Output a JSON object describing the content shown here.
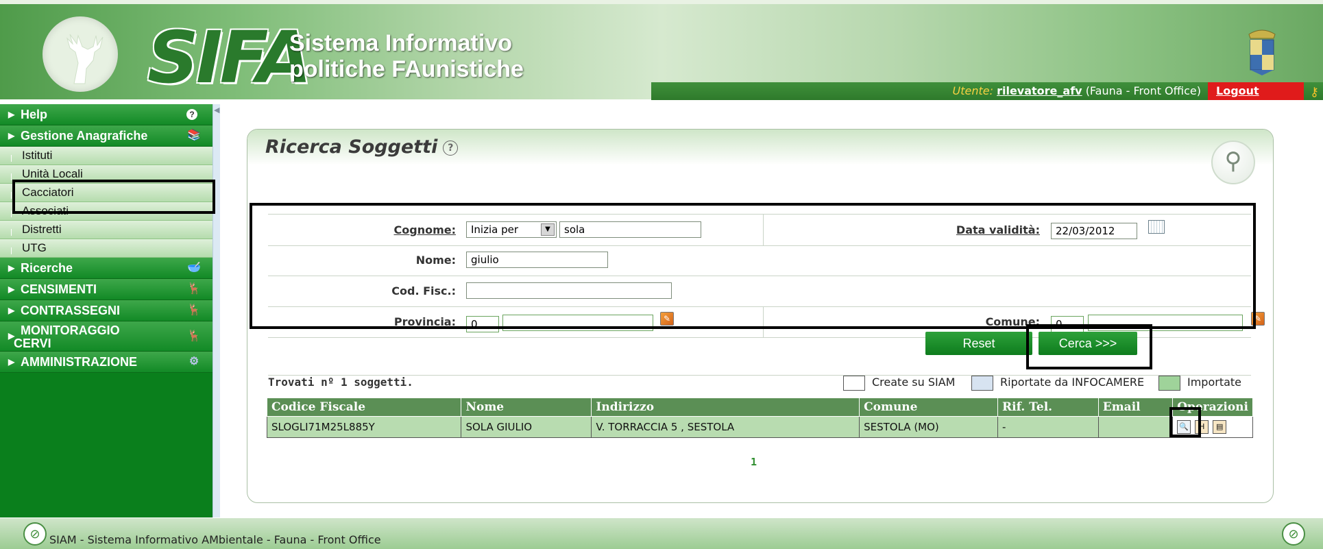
{
  "header": {
    "logo_text": "SIFA",
    "title_line1": "Sistema Informativo",
    "title_line2": "politiche FAunistiche",
    "user_label": "Utente:",
    "user_name": "rilevatore_afv",
    "user_role": "(Fauna - Front Office)",
    "logout": "Logout"
  },
  "sidebar": {
    "help": "Help",
    "gestione": "Gestione Anagrafiche",
    "items": [
      "Istituti",
      "Unità Locali",
      "Cacciatori",
      "Associati",
      "Distretti",
      "UTG"
    ],
    "ricerche": "Ricerche",
    "censimenti": "CENSIMENTI",
    "contrassegni": "CONTRASSEGNI",
    "monitoraggio_1": "MONITORAGGIO",
    "monitoraggio_2": "CERVI",
    "amministrazione": "AMMINISTRAZIONE"
  },
  "panel": {
    "title": "Ricerca Soggetti"
  },
  "form": {
    "cognome_label": "Cognome:",
    "cognome_mode": "Inizia per",
    "cognome_value": "sola",
    "data_label": "Data validità:",
    "data_value": "22/03/2012",
    "nome_label": "Nome:",
    "nome_value": "giulio",
    "codfisc_label": "Cod. Fisc.:",
    "codfisc_value": "",
    "provincia_label": "Provincia:",
    "provincia_code": "0",
    "provincia_name": "",
    "comune_label": "Comune:",
    "comune_code": "0",
    "comune_name": "",
    "reset": "Reset",
    "cerca": "Cerca >>>"
  },
  "results": {
    "found": "Trovati nº 1 soggetti.",
    "legend": {
      "create": "Create su SIAM",
      "riportate": "Riportate da INFOCAMERE",
      "importate": "Importate",
      "colors": {
        "create": "#ffffff",
        "riportate": "#d7e3f1",
        "importate": "#9fd39a"
      }
    },
    "columns": [
      "Codice Fiscale",
      "Nome",
      "Indirizzo",
      "Comune",
      "Rif. Tel.",
      "Email",
      "Operazioni"
    ],
    "rows": [
      [
        "SLOGLI71M25L885Y",
        "SOLA GIULIO",
        "V. TORRACCIA 5 , SESTOLA",
        "SESTOLA (MO)",
        "-",
        ""
      ]
    ],
    "page": "1"
  },
  "footer": {
    "text": "SIAM - Sistema Informativo AMbientale - Fauna - Front Office"
  },
  "colors": {
    "sidebar_green": "#0a7f1c",
    "button_green": "#1a8d2a",
    "logout_red": "#e01b1b",
    "table_header": "#5b8f55",
    "row_bg": "#b8dcb0"
  },
  "icons": [
    "help-icon",
    "books-icon",
    "ricerche-icon",
    "censimenti-icon",
    "contrassegni-icon",
    "monitoraggio-icon",
    "gear-icon",
    "calendar-icon",
    "pencil-icon",
    "magnifier-icon",
    "view-icon",
    "pdf-icon",
    "print-icon",
    "siam-icon"
  ]
}
